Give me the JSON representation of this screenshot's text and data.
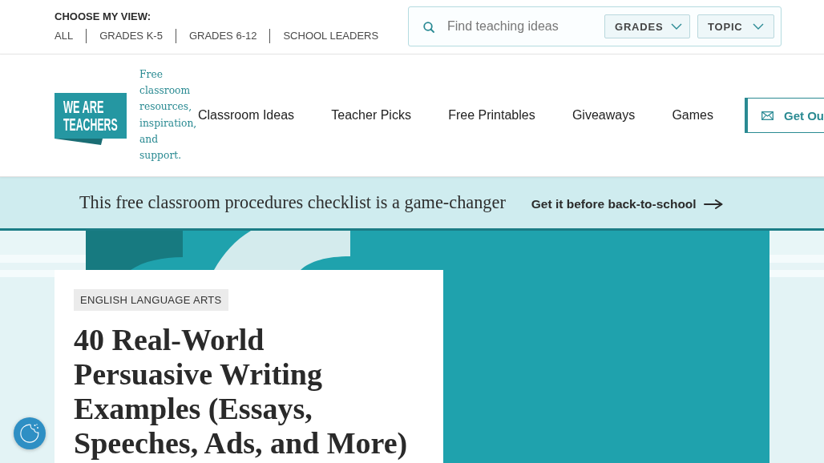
{
  "view_switcher": {
    "label": "CHOOSE MY VIEW:",
    "options": [
      "ALL",
      "GRADES K-5",
      "GRADES 6-12",
      "SCHOOL LEADERS"
    ]
  },
  "search": {
    "placeholder": "Find teaching ideas",
    "filters": [
      "GRADES",
      "TOPIC"
    ]
  },
  "logo": {
    "lines": [
      "WE ARE",
      "TEACHERS"
    ]
  },
  "tagline": "Free classroom resources, inspiration, and support.",
  "nav": {
    "items": [
      "Classroom Ideas",
      "Teacher Picks",
      "Free Printables",
      "Giveaways",
      "Games"
    ],
    "cta": {
      "label": "Get Ou"
    }
  },
  "promo": {
    "text": "This free classroom procedures checklist is a game-changer",
    "link": "Get it before back-to-school"
  },
  "article": {
    "category": "ENGLISH LANGUAGE ARTS",
    "title": "40 Real-World Persuasive Writing Examples (Essays, Speeches, Ads, and More)"
  }
}
